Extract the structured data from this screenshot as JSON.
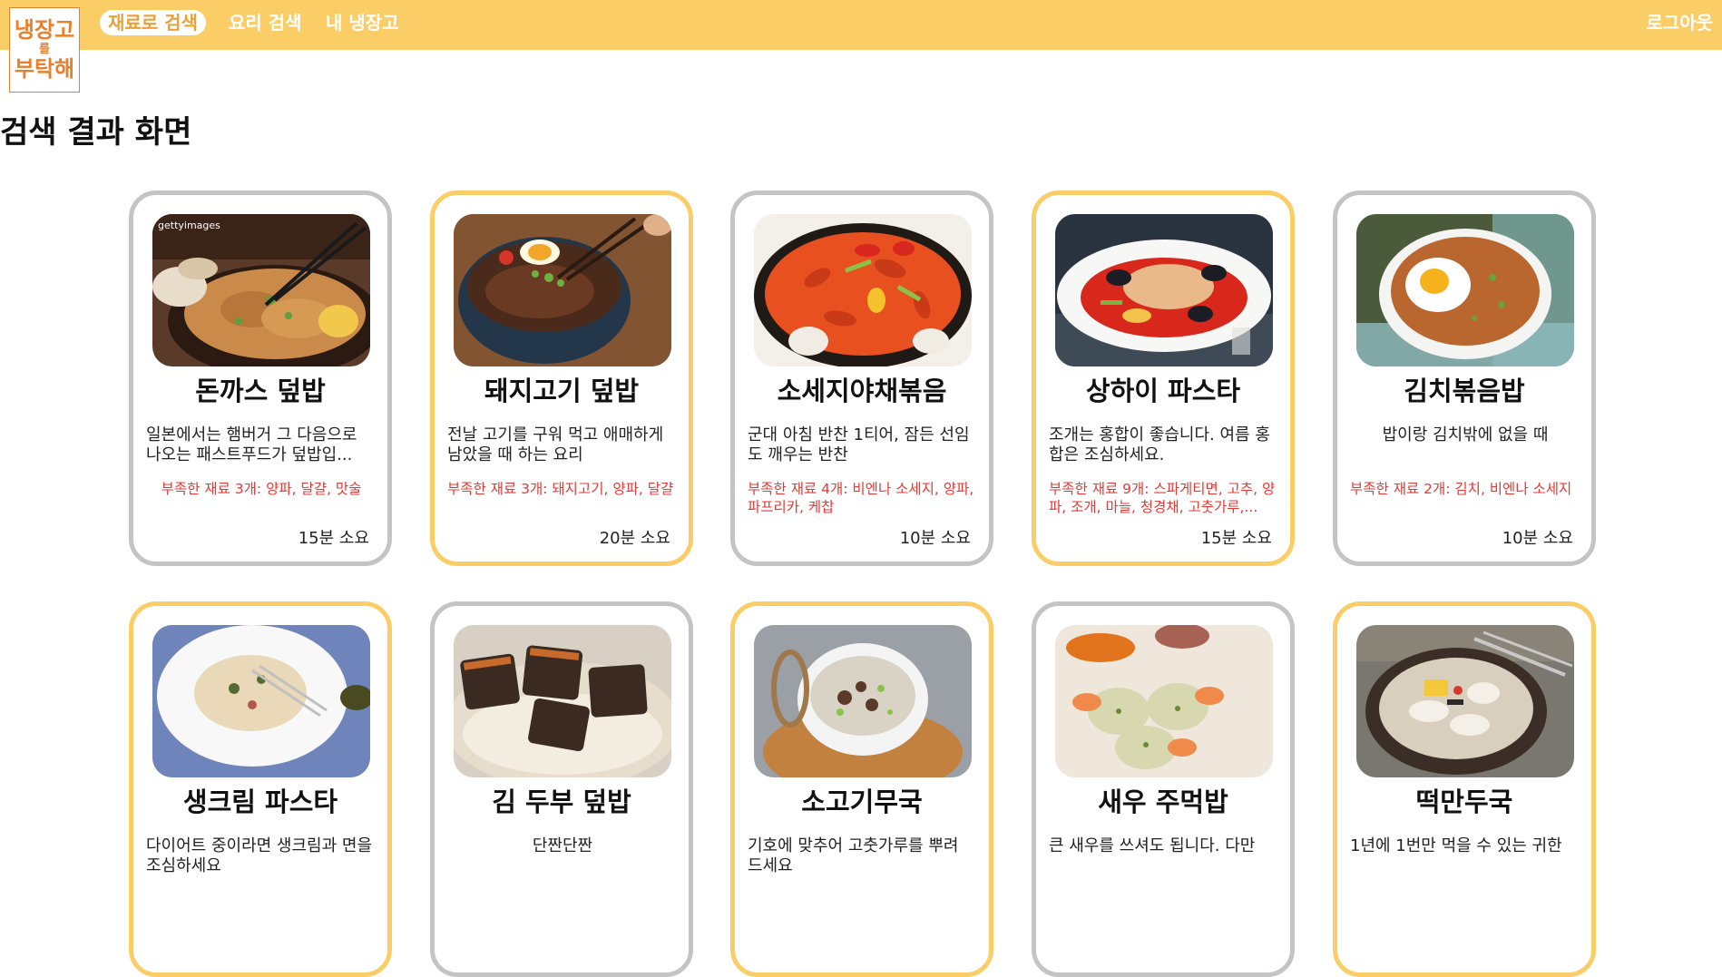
{
  "logo": {
    "line1": "냉장고",
    "line2": "를",
    "line3": "부탁해"
  },
  "nav": {
    "items": [
      {
        "label": "재료로 검색",
        "active": true
      },
      {
        "label": "요리 검색",
        "active": false
      },
      {
        "label": "내 냉장고",
        "active": false
      }
    ],
    "logout_label": "로그아웃"
  },
  "page": {
    "title": "검색 결과 화면"
  },
  "colors": {
    "nav_bg": "#fbcd66",
    "accent": "#e87f2c",
    "card_highlight": "#fbcd66",
    "card_border": "#c4c4c4",
    "missing_text": "#e53935"
  },
  "recipes": [
    {
      "name": "돈까스 덮밥",
      "description": "일본에서는 햄버거 그 다음으로 나오는 패스트푸드가 덮밥입...",
      "missing": "부족한 재료 3개: 양파, 달걀, 맛술",
      "time": "15분 소요",
      "image_icon": "donkatsu-rice-bowl-photo",
      "highlighted": false
    },
    {
      "name": "돼지고기 덮밥",
      "description": "전날 고기를 구워 먹고 애매하게 남았을 때 하는 요리",
      "missing": "부족한 재료 3개: 돼지고기, 양파, 달걀",
      "time": "20분 소요",
      "image_icon": "pork-rice-bowl-photo",
      "highlighted": true
    },
    {
      "name": "소세지야채볶음",
      "description": "군대 아침 반찬 1티어, 잠든 선임도 깨우는 반찬",
      "missing": "부족한 재료 4개: 비엔나 소세지, 양파, 파프리카, 케찹",
      "time": "10분 소요",
      "image_icon": "sausage-vegetable-stirfry-photo",
      "highlighted": false
    },
    {
      "name": "상하이 파스타",
      "description": "조개는 홍합이 좋습니다. 여름 홍합은 조심하세요.",
      "missing": "부족한 재료 9개: 스파게티면, 고추, 양파, 조개, 마늘, 청경채, 고춧가루,...",
      "time": "15분 소요",
      "image_icon": "shanghai-pasta-photo",
      "highlighted": true
    },
    {
      "name": "김치볶음밥",
      "description": "밥이랑 김치밖에 없을 때",
      "missing": "부족한 재료 2개: 김치, 비엔나 소세지",
      "time": "10분 소요",
      "image_icon": "kimchi-fried-rice-photo",
      "highlighted": false
    },
    {
      "name": "생크림 파스타",
      "description": "다이어트 중이라면 생크림과 면을 조심하세요",
      "missing": "",
      "time": "",
      "image_icon": "cream-pasta-photo",
      "highlighted": true
    },
    {
      "name": "김 두부 덮밥",
      "description": "단짠단짠",
      "missing": "",
      "time": "",
      "image_icon": "seaweed-tofu-rice-photo",
      "highlighted": false
    },
    {
      "name": "소고기무국",
      "description": "기호에 맞추어 고춧가루를 뿌려 드세요",
      "missing": "",
      "time": "",
      "image_icon": "beef-radish-soup-photo",
      "highlighted": true
    },
    {
      "name": "새우 주먹밥",
      "description": "큰 새우를 쓰셔도 됩니다. 다만",
      "missing": "",
      "time": "",
      "image_icon": "shrimp-rice-ball-photo",
      "highlighted": false
    },
    {
      "name": "떡만두국",
      "description": "1년에 1번만 먹을 수 있는 귀한",
      "missing": "",
      "time": "",
      "image_icon": "rice-cake-dumpling-soup-photo",
      "highlighted": true
    }
  ]
}
